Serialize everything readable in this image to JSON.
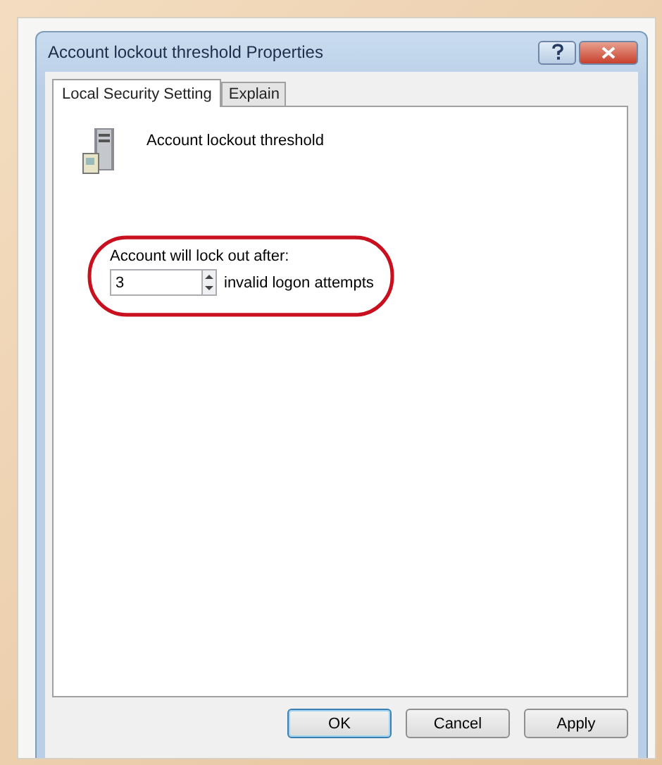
{
  "window": {
    "title": "Account lockout threshold Properties"
  },
  "tabs": [
    {
      "label": "Local Security Setting",
      "selected": true
    },
    {
      "label": "Explain",
      "selected": false
    }
  ],
  "policy": {
    "name": "Account lockout threshold"
  },
  "setting": {
    "label": "Account will lock out after:",
    "value": "3",
    "suffix": "invalid logon attempts",
    "highlighted": true
  },
  "buttons": [
    {
      "label": "OK",
      "default": true
    },
    {
      "label": "Cancel",
      "default": false
    },
    {
      "label": "Apply",
      "default": false
    }
  ]
}
